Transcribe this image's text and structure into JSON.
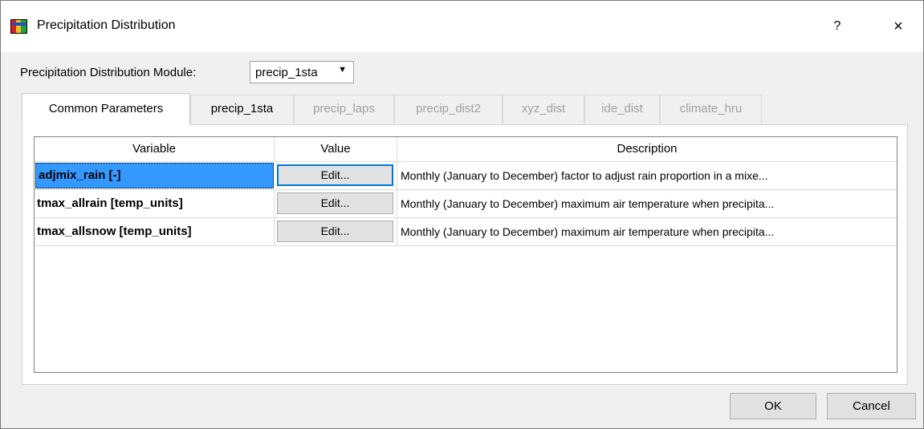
{
  "window": {
    "title": "Precipitation Distribution",
    "help_label": "?",
    "close_label": "×"
  },
  "module": {
    "label": "Precipitation Distribution Module:",
    "selected": "precip_1sta",
    "arrow": "▼"
  },
  "tabs": [
    {
      "label": "Common Parameters",
      "state": "active"
    },
    {
      "label": "precip_1sta",
      "state": "enabled"
    },
    {
      "label": "precip_laps",
      "state": "disabled"
    },
    {
      "label": "precip_dist2",
      "state": "disabled"
    },
    {
      "label": "xyz_dist",
      "state": "disabled"
    },
    {
      "label": "ide_dist",
      "state": "disabled"
    },
    {
      "label": "climate_hru",
      "state": "disabled"
    }
  ],
  "table": {
    "headers": {
      "variable": "Variable",
      "value": "Value",
      "description": "Description"
    },
    "rows": [
      {
        "variable": "adjmix_rain [-]",
        "value": "Edit...",
        "description": "Monthly (January to December) factor to adjust rain proportion in a mixe..."
      },
      {
        "variable": "tmax_allrain [temp_units]",
        "value": "Edit...",
        "description": "Monthly (January to December) maximum air temperature when precipita..."
      },
      {
        "variable": "tmax_allsnow [temp_units]",
        "value": "Edit...",
        "description": "Monthly (January to December) maximum air temperature when precipita..."
      }
    ]
  },
  "buttons": {
    "ok": "OK",
    "cancel": "Cancel"
  }
}
